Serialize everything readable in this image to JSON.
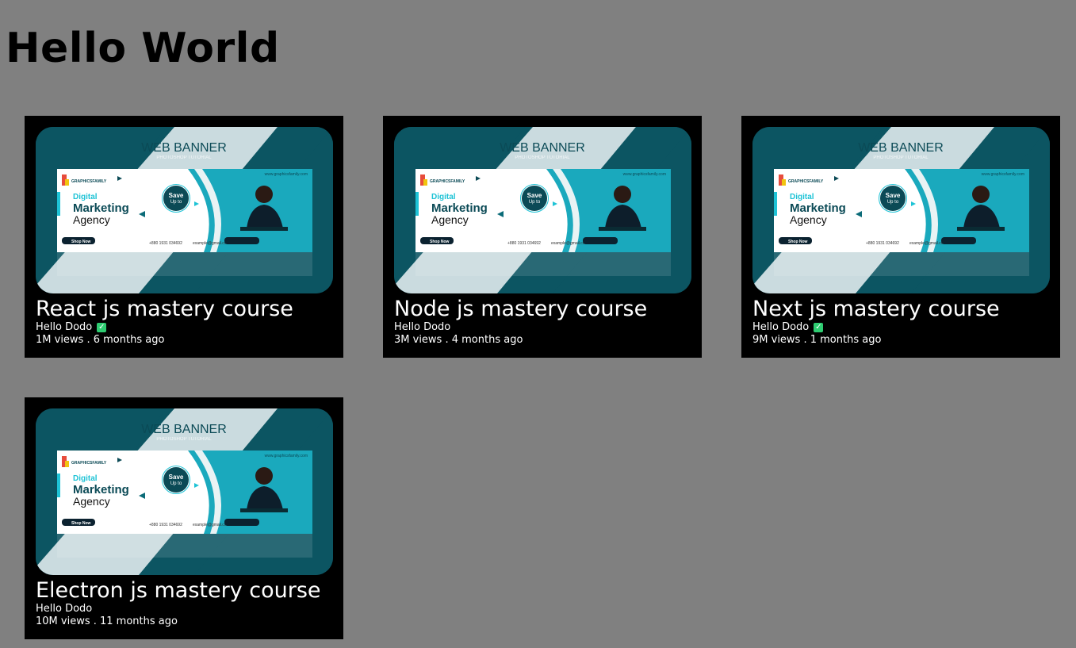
{
  "page": {
    "title": "Hello World"
  },
  "banner": {
    "heading": "WEB BANNER",
    "subheading": "PHOTOSHOP TUTORIAL",
    "brand": "GRAPHICSFAMILY",
    "website": "www.graphicsfamily.com",
    "line1": "Digital",
    "line2": "Marketing",
    "line3": "Agency",
    "save_line1": "Save",
    "save_line2": "Up to",
    "cta": "Shop Now",
    "phone": "+880 1931 034692",
    "email": "example@gmail.com",
    "accent_color": "#1ec3d6",
    "dark_color": "#0b4a56"
  },
  "videos": [
    {
      "title": "React js mastery course",
      "channel": "Hello Dodo",
      "verified": true,
      "views": "1M views",
      "age": "6 months ago"
    },
    {
      "title": "Node js mastery course",
      "channel": "Hello Dodo",
      "verified": false,
      "views": "3M views",
      "age": "4 months ago"
    },
    {
      "title": "Next js mastery course",
      "channel": "Hello Dodo",
      "verified": true,
      "views": "9M views",
      "age": "1 months ago"
    },
    {
      "title": "Electron js mastery course",
      "channel": "Hello Dodo",
      "verified": false,
      "views": "10M views",
      "age": "11 months ago"
    }
  ]
}
